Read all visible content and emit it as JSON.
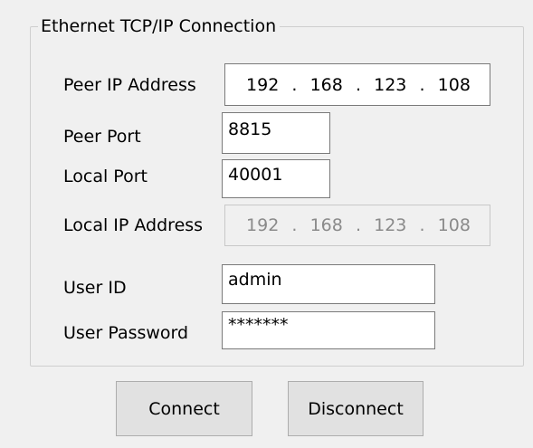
{
  "group": {
    "title": "Ethernet TCP/IP Connection"
  },
  "fields": {
    "peer_ip": {
      "label": "Peer IP Address",
      "octets": [
        "192",
        "168",
        "123",
        "108"
      ]
    },
    "peer_port": {
      "label": "Peer Port",
      "value": "8815"
    },
    "local_port": {
      "label": "Local Port",
      "value": "40001"
    },
    "local_ip": {
      "label": "Local IP Address",
      "octets": [
        "192",
        "168",
        "123",
        "108"
      ]
    },
    "user_id": {
      "label": "User ID",
      "value": "admin"
    },
    "password": {
      "label": "User Password",
      "value": "*******"
    }
  },
  "ip_separator": ".",
  "buttons": {
    "connect": "Connect",
    "disconnect": "Disconnect"
  }
}
